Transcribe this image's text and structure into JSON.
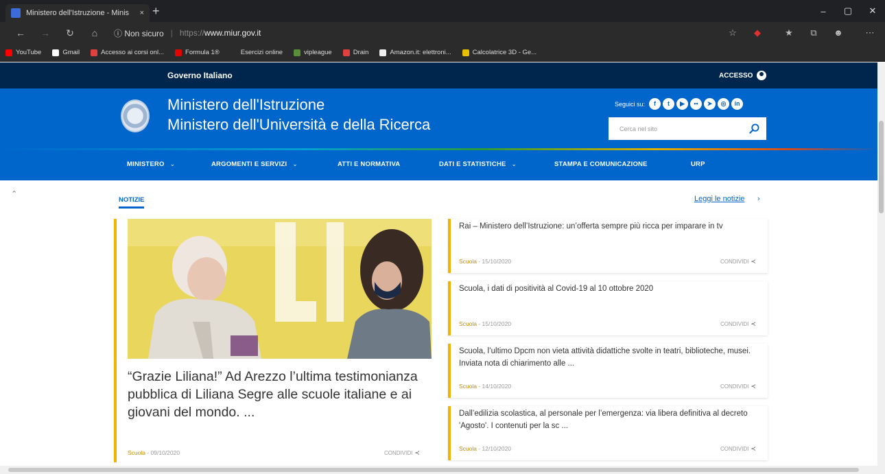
{
  "browser": {
    "tab_title": "Ministero dell'Istruzione - Minis",
    "tab_close": "×",
    "new_tab": "+",
    "window_controls": {
      "minimize": "–",
      "maximize": "▢",
      "close": "✕"
    },
    "security_label": "Non sicuro",
    "url_protocol": "https://",
    "url_host": "www.miur.gov.it",
    "bookmarks": [
      {
        "label": "YouTube",
        "color": "#ff0000"
      },
      {
        "label": "Gmail",
        "color": "#ffffff"
      },
      {
        "label": "Accesso ai corsi onl...",
        "color": "#e04040"
      },
      {
        "label": "Formula 1®",
        "color": "#e10600"
      },
      {
        "label": "Esercizi online",
        "color": "#2b2b2b"
      },
      {
        "label": "vipleague",
        "color": "#5a8f3a"
      },
      {
        "label": "Drain",
        "color": "#e04040"
      },
      {
        "label": "Amazon.it: elettroni...",
        "color": "#eeeeee"
      },
      {
        "label": "Calcolatrice 3D - Ge...",
        "color": "#e8c000"
      }
    ]
  },
  "site": {
    "gov_title": "Governo Italiano",
    "access_label": "ACCESSO",
    "ministry_line1": "Ministero dell'Istruzione",
    "ministry_line2": "Ministero dell'Università e della Ricerca",
    "follow_label": "Seguici su:",
    "social_icons": [
      "facebook-icon",
      "twitter-icon",
      "youtube-icon",
      "flickr-icon",
      "telegram-icon",
      "instagram-icon",
      "linkedin-icon"
    ],
    "search_placeholder": "Cerca nel sito",
    "nav": [
      {
        "label": "MINISTERO",
        "caret": "⌄"
      },
      {
        "label": "ARGOMENTI E SERVIZI",
        "caret": "⌄"
      },
      {
        "label": "ATTI E NORMATIVA",
        "caret": ""
      },
      {
        "label": "DATI E STATISTICHE",
        "caret": "⌄"
      },
      {
        "label": "STAMPA E COMUNICAZIONE",
        "caret": ""
      },
      {
        "label": "URP",
        "caret": ""
      }
    ]
  },
  "news_section": {
    "tab_label": "NOTIZIE",
    "read_all": "Leggi le notizie",
    "read_all_arrow": "›",
    "share_label": "CONDIVIDI",
    "featured": {
      "title": "“Grazie Liliana!” Ad Arezzo l’ultima testimonianza pubblica di Liliana Segre alle scuole italiane e ai giovani del mondo. ...",
      "category": "Scuola",
      "date": " - 09/10/2020"
    },
    "items": [
      {
        "title": "Rai – Ministero dell’Istruzione: un’offerta sempre più ricca per imparare in tv",
        "category": "Scuola",
        "date": " - 15/10/2020"
      },
      {
        "title": "Scuola, i dati di positività al Covid-19 al 10 ottobre 2020",
        "category": "Scuola",
        "date": " - 15/10/2020"
      },
      {
        "title": "Scuola, l’ultimo Dpcm non vieta attività didattiche svolte in teatri, biblioteche, musei. Inviata nota di chiarimento alle ...",
        "category": "Scuola",
        "date": " - 14/10/2020"
      },
      {
        "title": "Dall’edilizia scolastica, al personale per l’emergenza: via libera definitiva al decreto 'Agosto'. I contenuti per la sc ...",
        "category": "Scuola",
        "date": " - 12/10/2020"
      }
    ]
  }
}
